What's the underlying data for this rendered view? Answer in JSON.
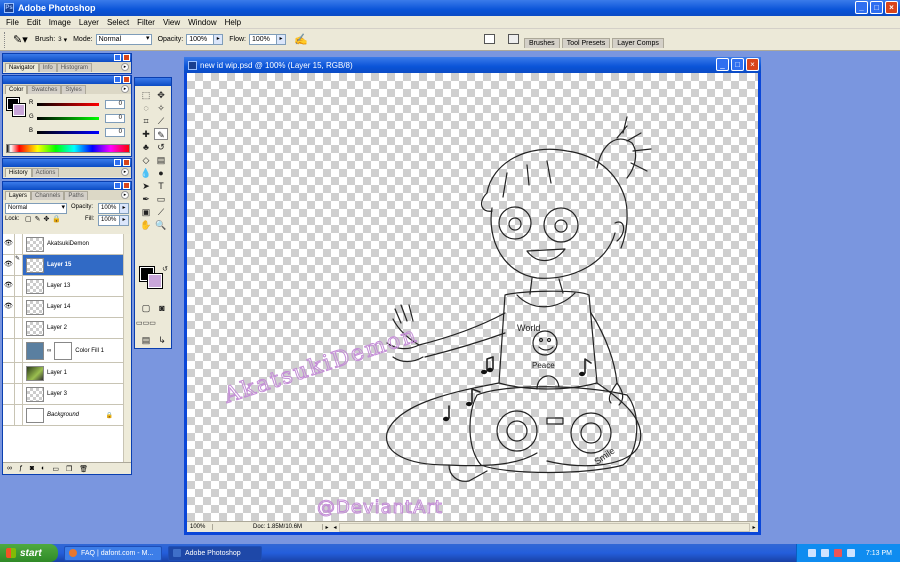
{
  "app": {
    "title": "Adobe Photoshop"
  },
  "menu": [
    "File",
    "Edit",
    "Image",
    "Layer",
    "Select",
    "Filter",
    "View",
    "Window",
    "Help"
  ],
  "options": {
    "brush_label": "Brush:",
    "brush_size": "3",
    "mode_label": "Mode:",
    "mode_value": "Normal",
    "opacity_label": "Opacity:",
    "opacity_value": "100%",
    "flow_label": "Flow:",
    "flow_value": "100%"
  },
  "palette_well": [
    "Brushes",
    "Tool Presets",
    "Layer Comps"
  ],
  "navigator_palette": {
    "tabs": [
      "Navigator",
      "Info",
      "Histogram"
    ]
  },
  "color_palette": {
    "tabs": [
      "Color",
      "Swatches",
      "Styles"
    ],
    "rows": [
      {
        "label": "R",
        "value": "0"
      },
      {
        "label": "G",
        "value": "0"
      },
      {
        "label": "B",
        "value": "0"
      }
    ],
    "foreground": "#000000",
    "background": "#c9a6d9"
  },
  "history_palette": {
    "tabs": [
      "History",
      "Actions"
    ]
  },
  "layers_palette": {
    "tabs": [
      "Layers",
      "Channels",
      "Paths"
    ],
    "blend_mode": "Normal",
    "opacity_label": "Opacity:",
    "opacity_value": "100%",
    "lock_label": "Lock:",
    "fill_label": "Fill:",
    "fill_value": "100%",
    "layers": [
      {
        "name": "AkatsukiDemon",
        "visible": true,
        "selected": false
      },
      {
        "name": "Layer 15",
        "visible": true,
        "selected": true
      },
      {
        "name": "Layer 13",
        "visible": true,
        "selected": false
      },
      {
        "name": "Layer 14",
        "visible": true,
        "selected": false
      },
      {
        "name": "Layer 2",
        "visible": false,
        "selected": false
      },
      {
        "name": "Color Fill 1",
        "visible": false,
        "selected": false
      },
      {
        "name": "Layer 1",
        "visible": false,
        "selected": false
      },
      {
        "name": "Layer 3",
        "visible": false,
        "selected": false
      },
      {
        "name": "Background",
        "visible": false,
        "selected": false
      }
    ]
  },
  "document": {
    "title": "new id wip.psd @ 100% (Layer 15, RGB/8)",
    "zoom": "100%",
    "doc_info": "Doc: 1.85M/10.6M",
    "watermark_signature": "AkatsukiDemon",
    "watermark_site": "@DeviantArt",
    "shirt_text_top": "World",
    "shirt_text_bottom": "Peace",
    "boombox_text": "Smile"
  },
  "taskbar": {
    "start_label": "start",
    "tasks": [
      "FAQ | dafont.com - M...",
      "Adobe Photoshop"
    ],
    "clock": "7:13 PM"
  }
}
